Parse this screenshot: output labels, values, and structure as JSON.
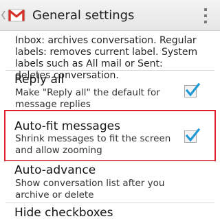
{
  "action_bar": {
    "title": "General settings",
    "app_icon": "gmail-icon",
    "up_icon": "caret-left-icon",
    "overflow_icon": "overflow-menu-icon"
  },
  "partial_item": {
    "summary": "Inbox: archives conversation. Regular labels: removes current label. System labels such as All mail or Sent: deletes conversation."
  },
  "settings": {
    "reply_all": {
      "title": "Reply all",
      "summary": "Make \"Reply all\" the default for message replies",
      "checked": true
    },
    "auto_fit": {
      "title": "Auto-fit messages",
      "summary": "Shrink messages to fit the screen and allow zooming",
      "checked": true
    },
    "auto_advance": {
      "title": "Auto-advance",
      "summary": "Show conversation list after you archive or delete"
    },
    "hide_checkboxes": {
      "title": "Hide checkboxes"
    }
  },
  "colors": {
    "highlight": "#e0202a",
    "check": "#1f9ad6"
  }
}
